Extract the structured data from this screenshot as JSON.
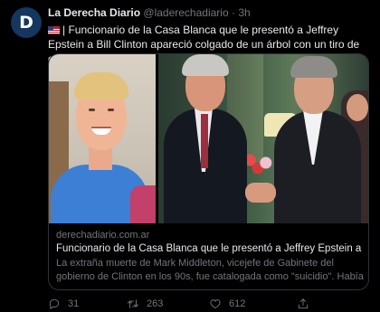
{
  "tweet": {
    "author_initial": "D",
    "author_name": "La Derecha Diario",
    "handle": "@laderechadiario",
    "separator": "·",
    "time": "3h",
    "text": "| Funcionario de la Casa Blanca que le presentó a Jeffrey Epstein a Bill Clinton apareció colgado de un árbol con un tiro de escopeta en el pecho.",
    "flag_icon": "us-flag-icon"
  },
  "card": {
    "domain": "derechadiario.com.ar",
    "title": "Funcionario de la Casa Blanca que le presentó a Jeffrey Epstein a Bill ...",
    "description": "La extraña muerte de Mark Middleton, vicejefe de Gabinete del gobierno de Clinton en los 90s, fue catalogada como \"suicidio\". Había ..."
  },
  "actions": {
    "replies": "31",
    "retweets": "263",
    "likes": "612"
  },
  "colors": {
    "background": "#000000",
    "text_primary": "#e7e9ea",
    "text_secondary": "#71767b",
    "border": "#2f3336",
    "avatar_bg": "#14365f"
  }
}
